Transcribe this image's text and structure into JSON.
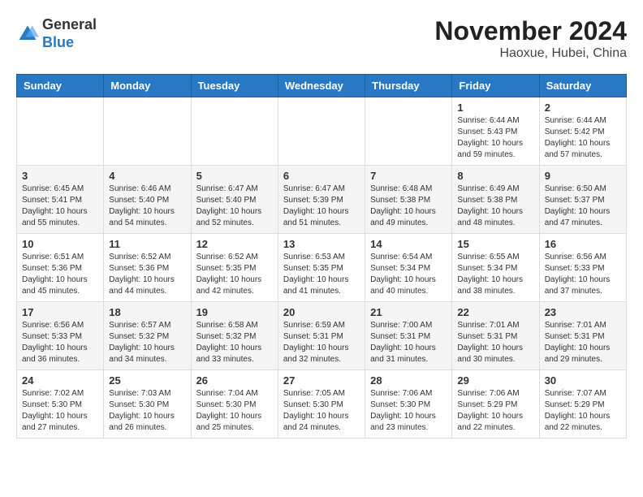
{
  "header": {
    "logo_general": "General",
    "logo_blue": "Blue",
    "month_title": "November 2024",
    "location": "Haoxue, Hubei, China"
  },
  "days_of_week": [
    "Sunday",
    "Monday",
    "Tuesday",
    "Wednesday",
    "Thursday",
    "Friday",
    "Saturday"
  ],
  "weeks": [
    [
      {
        "day": "",
        "info": ""
      },
      {
        "day": "",
        "info": ""
      },
      {
        "day": "",
        "info": ""
      },
      {
        "day": "",
        "info": ""
      },
      {
        "day": "",
        "info": ""
      },
      {
        "day": "1",
        "info": "Sunrise: 6:44 AM\nSunset: 5:43 PM\nDaylight: 10 hours\nand 59 minutes."
      },
      {
        "day": "2",
        "info": "Sunrise: 6:44 AM\nSunset: 5:42 PM\nDaylight: 10 hours\nand 57 minutes."
      }
    ],
    [
      {
        "day": "3",
        "info": "Sunrise: 6:45 AM\nSunset: 5:41 PM\nDaylight: 10 hours\nand 55 minutes."
      },
      {
        "day": "4",
        "info": "Sunrise: 6:46 AM\nSunset: 5:40 PM\nDaylight: 10 hours\nand 54 minutes."
      },
      {
        "day": "5",
        "info": "Sunrise: 6:47 AM\nSunset: 5:40 PM\nDaylight: 10 hours\nand 52 minutes."
      },
      {
        "day": "6",
        "info": "Sunrise: 6:47 AM\nSunset: 5:39 PM\nDaylight: 10 hours\nand 51 minutes."
      },
      {
        "day": "7",
        "info": "Sunrise: 6:48 AM\nSunset: 5:38 PM\nDaylight: 10 hours\nand 49 minutes."
      },
      {
        "day": "8",
        "info": "Sunrise: 6:49 AM\nSunset: 5:38 PM\nDaylight: 10 hours\nand 48 minutes."
      },
      {
        "day": "9",
        "info": "Sunrise: 6:50 AM\nSunset: 5:37 PM\nDaylight: 10 hours\nand 47 minutes."
      }
    ],
    [
      {
        "day": "10",
        "info": "Sunrise: 6:51 AM\nSunset: 5:36 PM\nDaylight: 10 hours\nand 45 minutes."
      },
      {
        "day": "11",
        "info": "Sunrise: 6:52 AM\nSunset: 5:36 PM\nDaylight: 10 hours\nand 44 minutes."
      },
      {
        "day": "12",
        "info": "Sunrise: 6:52 AM\nSunset: 5:35 PM\nDaylight: 10 hours\nand 42 minutes."
      },
      {
        "day": "13",
        "info": "Sunrise: 6:53 AM\nSunset: 5:35 PM\nDaylight: 10 hours\nand 41 minutes."
      },
      {
        "day": "14",
        "info": "Sunrise: 6:54 AM\nSunset: 5:34 PM\nDaylight: 10 hours\nand 40 minutes."
      },
      {
        "day": "15",
        "info": "Sunrise: 6:55 AM\nSunset: 5:34 PM\nDaylight: 10 hours\nand 38 minutes."
      },
      {
        "day": "16",
        "info": "Sunrise: 6:56 AM\nSunset: 5:33 PM\nDaylight: 10 hours\nand 37 minutes."
      }
    ],
    [
      {
        "day": "17",
        "info": "Sunrise: 6:56 AM\nSunset: 5:33 PM\nDaylight: 10 hours\nand 36 minutes."
      },
      {
        "day": "18",
        "info": "Sunrise: 6:57 AM\nSunset: 5:32 PM\nDaylight: 10 hours\nand 34 minutes."
      },
      {
        "day": "19",
        "info": "Sunrise: 6:58 AM\nSunset: 5:32 PM\nDaylight: 10 hours\nand 33 minutes."
      },
      {
        "day": "20",
        "info": "Sunrise: 6:59 AM\nSunset: 5:31 PM\nDaylight: 10 hours\nand 32 minutes."
      },
      {
        "day": "21",
        "info": "Sunrise: 7:00 AM\nSunset: 5:31 PM\nDaylight: 10 hours\nand 31 minutes."
      },
      {
        "day": "22",
        "info": "Sunrise: 7:01 AM\nSunset: 5:31 PM\nDaylight: 10 hours\nand 30 minutes."
      },
      {
        "day": "23",
        "info": "Sunrise: 7:01 AM\nSunset: 5:31 PM\nDaylight: 10 hours\nand 29 minutes."
      }
    ],
    [
      {
        "day": "24",
        "info": "Sunrise: 7:02 AM\nSunset: 5:30 PM\nDaylight: 10 hours\nand 27 minutes."
      },
      {
        "day": "25",
        "info": "Sunrise: 7:03 AM\nSunset: 5:30 PM\nDaylight: 10 hours\nand 26 minutes."
      },
      {
        "day": "26",
        "info": "Sunrise: 7:04 AM\nSunset: 5:30 PM\nDaylight: 10 hours\nand 25 minutes."
      },
      {
        "day": "27",
        "info": "Sunrise: 7:05 AM\nSunset: 5:30 PM\nDaylight: 10 hours\nand 24 minutes."
      },
      {
        "day": "28",
        "info": "Sunrise: 7:06 AM\nSunset: 5:30 PM\nDaylight: 10 hours\nand 23 minutes."
      },
      {
        "day": "29",
        "info": "Sunrise: 7:06 AM\nSunset: 5:29 PM\nDaylight: 10 hours\nand 22 minutes."
      },
      {
        "day": "30",
        "info": "Sunrise: 7:07 AM\nSunset: 5:29 PM\nDaylight: 10 hours\nand 22 minutes."
      }
    ]
  ]
}
